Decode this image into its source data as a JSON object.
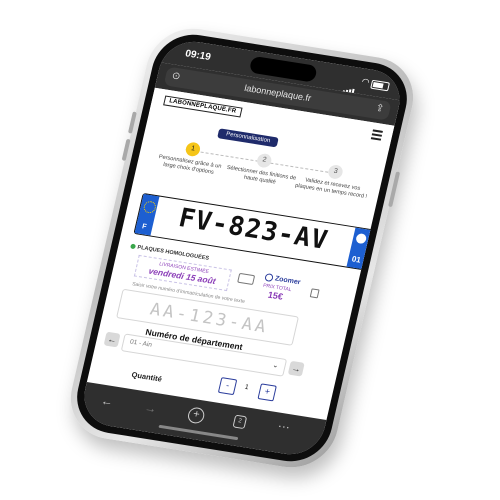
{
  "status_bar": {
    "time": "09:19"
  },
  "browser": {
    "url": "labonneplaque.fr"
  },
  "site": {
    "logo_text": "LABONNEPLAQUE.FR",
    "personalization_label": "Personnalisation"
  },
  "steps": [
    {
      "number": "1",
      "text": "Personnalisez grâce à un large choix d'options",
      "active": true
    },
    {
      "number": "2",
      "text": "Sélectionner des finitions de haute qualité",
      "active": false
    },
    {
      "number": "3",
      "text": "Validez et recevez vos plaques en un temps record !",
      "active": false
    }
  ],
  "plate": {
    "number": "FV-823-AV",
    "country_letter": "F",
    "region_number": "01",
    "band_color": "#1d5fd1"
  },
  "order": {
    "homologation_label": "PLAQUES HOMOLOGUÉES",
    "delivery_label": "LIVRAISON ESTIMÉE",
    "delivery_date": "vendredi 15 août",
    "zoom_label": "Zoomer",
    "price_label": "PRIX TOTAL",
    "price_value": "15€"
  },
  "form": {
    "registration_hint": "Saisir votre numéro d'immatriculation de votre texte",
    "registration_placeholder": "AA-123-AA",
    "department_title": "Numéro de département",
    "department_value": "01 - Ain",
    "quantity_label": "Quantité",
    "quantity_value": "1",
    "decrement": "-",
    "increment": "+"
  },
  "colors": {
    "accent_yellow": "#f5c518",
    "navy": "#1f2b6b",
    "purple": "#8b3db8",
    "link_blue": "#2b3d9c"
  },
  "toolbar_icons": [
    "back-arrow-icon",
    "forward-arrow-icon",
    "new-tab-icon",
    "tabs-icon",
    "more-icon"
  ],
  "toolbar": {
    "tab_count": "2"
  }
}
